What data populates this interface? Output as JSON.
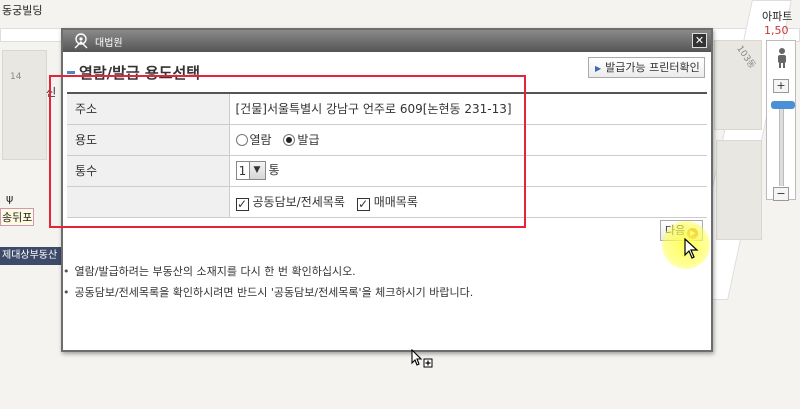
{
  "map": {
    "labels": {
      "top_left_building": "동궁빌딩",
      "top_right": "아파트",
      "top_red_number": "1,50",
      "lot_number_14": "14",
      "side_char": "신",
      "road_number": "103동",
      "restaurant": "송뒤포",
      "bottom_strip": "제대상부동산"
    },
    "zoom": {
      "plus": "+",
      "minus": "−"
    }
  },
  "dialog": {
    "titlebar_text": "대법원",
    "close_symbol": "✕",
    "heading": "열람/발급 용도선택",
    "printer_button": "발급가능 프린터확인",
    "rows": {
      "address": {
        "label": "주소",
        "value": "[건물]서울특별시 강남구 언주로 609[논현동 231-13]"
      },
      "purpose": {
        "label": "용도",
        "options": [
          {
            "label": "열람",
            "selected": false
          },
          {
            "label": "발급",
            "selected": true
          }
        ]
      },
      "copies": {
        "label": "통수",
        "value": "1",
        "unit": "통"
      },
      "extras": {
        "options": [
          {
            "label": "공동담보/전세목록",
            "checked": true
          },
          {
            "label": "매매목록",
            "checked": true
          }
        ]
      }
    },
    "next_button": "다음",
    "notes": [
      "열람/발급하려는 부동산의 소재지를 다시 한 번 확인하십시오.",
      "공동담보/전세목록을 확인하시려면 반드시 '공동담보/전세목록'을 체크하시기 바랍니다."
    ]
  },
  "colors": {
    "annotation_box": "#e5243a",
    "cursor_highlight": "#ffff50",
    "heading_accent": "#4f84c4",
    "next_icon": "#e08a1e"
  }
}
